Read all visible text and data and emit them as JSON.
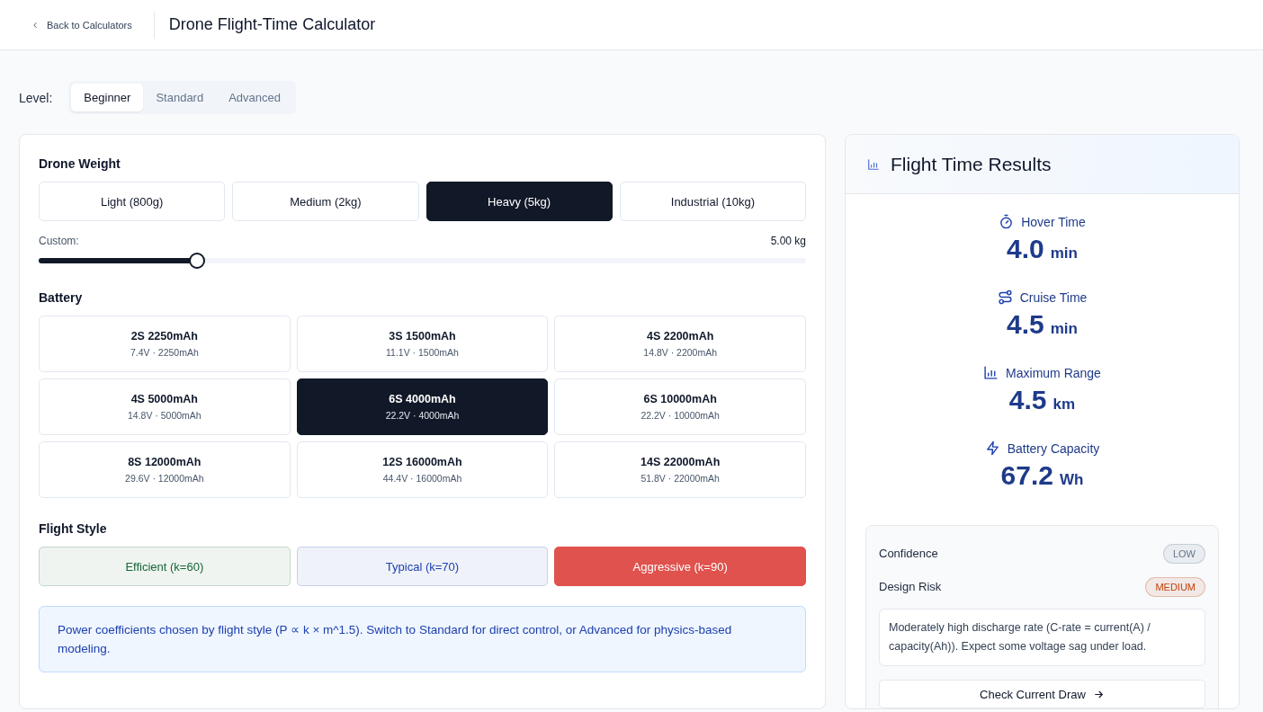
{
  "header": {
    "back_link": "Back to Calculators",
    "title": "Drone Flight-Time Calculator"
  },
  "level": {
    "label": "Level:",
    "tabs": [
      {
        "label": "Beginner",
        "selected": true
      },
      {
        "label": "Standard",
        "selected": false
      },
      {
        "label": "Advanced",
        "selected": false
      }
    ]
  },
  "drone_weight": {
    "title": "Drone Weight",
    "options": [
      {
        "label": "Light (800g)",
        "selected": false
      },
      {
        "label": "Medium (2kg)",
        "selected": false
      },
      {
        "label": "Heavy (5kg)",
        "selected": true
      },
      {
        "label": "Industrial (10kg)",
        "selected": false
      }
    ],
    "custom": {
      "label": "Custom:",
      "reading": "5.00 kg",
      "level": 0.2
    }
  },
  "battery": {
    "title": "Battery",
    "options": [
      {
        "name": "2S 2250mAh",
        "detail": "7.4V · 2250mAh",
        "selected": false
      },
      {
        "name": "3S 1500mAh",
        "detail": "11.1V · 1500mAh",
        "selected": false
      },
      {
        "name": "4S 2200mAh",
        "detail": "14.8V · 2200mAh",
        "selected": false
      },
      {
        "name": "4S 5000mAh",
        "detail": "14.8V · 5000mAh",
        "selected": false
      },
      {
        "name": "6S 4000mAh",
        "detail": "22.2V · 4000mAh",
        "selected": true
      },
      {
        "name": "6S 10000mAh",
        "detail": "22.2V · 10000mAh",
        "selected": false
      },
      {
        "name": "8S 12000mAh",
        "detail": "29.6V · 12000mAh",
        "selected": false
      },
      {
        "name": "12S 16000mAh",
        "detail": "44.4V · 16000mAh",
        "selected": false
      },
      {
        "name": "14S 22000mAh",
        "detail": "51.8V · 22000mAh",
        "selected": false
      }
    ]
  },
  "flight_style": {
    "title": "Flight Style",
    "options": [
      {
        "label": "Efficient (k=60)",
        "selected": false,
        "color": "#166534"
      },
      {
        "label": "Typical (k=70)",
        "selected": false,
        "color": "#1e40af"
      },
      {
        "label": "Aggressive (k=90)",
        "selected": true,
        "color": "#e0524d"
      }
    ],
    "note": "Power coefficients chosen by flight style (P ∝ k × m^1.5). Switch to Standard for direct control, or Advanced for physics-based modeling."
  },
  "results": {
    "title": "Flight Time Results",
    "metrics": [
      {
        "kind": "timer",
        "label": "Hover Time",
        "value": "4.0",
        "unit": "min"
      },
      {
        "kind": "route",
        "label": "Cruise Time",
        "value": "4.5",
        "unit": "min"
      },
      {
        "kind": "chart",
        "label": "Maximum Range",
        "value": "4.5",
        "unit": "km"
      },
      {
        "kind": "bolt",
        "label": "Battery Capacity",
        "value": "67.2",
        "unit": "Wh"
      }
    ],
    "assessment": [
      {
        "label": "Confidence",
        "badge": "LOW",
        "color": "#64748b"
      },
      {
        "label": "Design Risk",
        "badge": "MEDIUM",
        "color": "#c2410c"
      }
    ],
    "message": "Moderately high discharge rate (C-rate = current(A) / capacity(Ah)). Expect some voltage sag under load.",
    "action": "Check Current Draw"
  }
}
